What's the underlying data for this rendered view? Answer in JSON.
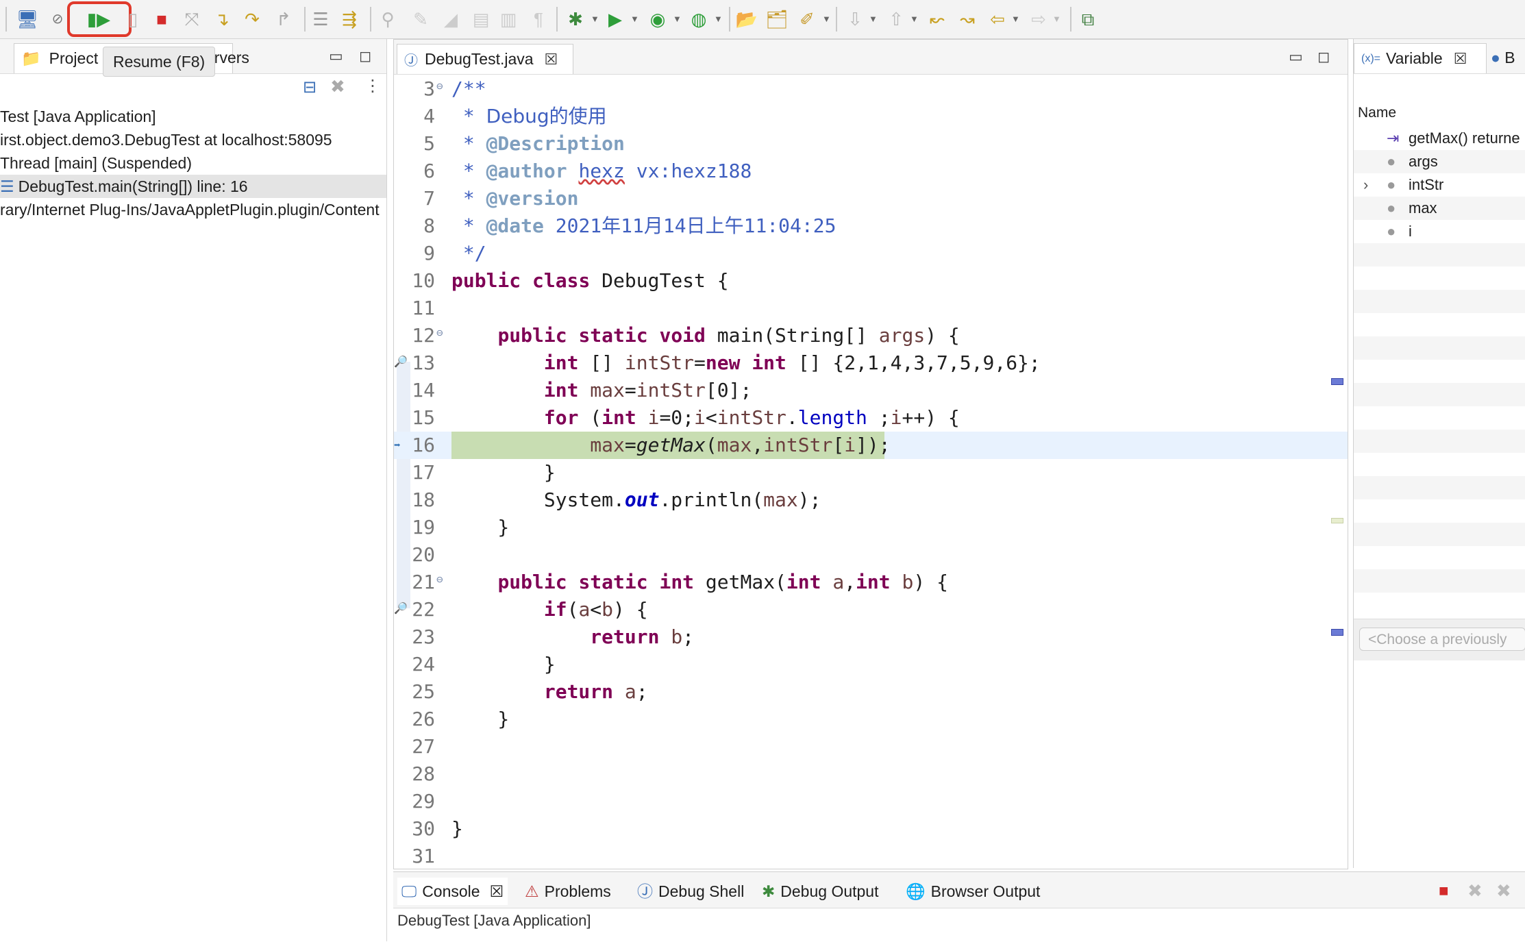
{
  "toolbar": {
    "tooltip": "Resume (F8)",
    "icons": [
      "display-icon",
      "skip-breakpoints-icon",
      "resume-icon",
      "suspend-icon",
      "terminate-icon",
      "disconnect-icon",
      "step-into-icon",
      "step-over-icon",
      "step-return-icon",
      "drop-to-frame-icon",
      "use-step-filters-icon",
      "debug-icon",
      "run-icon",
      "coverage-icon",
      "external-tools-icon",
      "open-type-icon",
      "open-task-icon",
      "search-icon",
      "next-annotation-icon",
      "prev-annotation-icon",
      "back-icon",
      "forward-icon",
      "new-window-icon"
    ]
  },
  "left_panel": {
    "tabs": {
      "project": "Project E",
      "servers": "ervers"
    },
    "tree": [
      "Test [Java Application]",
      "irst.object.demo3.DebugTest at localhost:58095",
      "Thread [main] (Suspended)",
      "DebugTest.main(String[]) line: 16",
      "rary/Internet Plug-Ins/JavaAppletPlugin.plugin/Content"
    ]
  },
  "editor": {
    "tab": "DebugTest.java",
    "line_numbers": [
      "3",
      "4",
      "5",
      "6",
      "7",
      "8",
      "9",
      "10",
      "11",
      "12",
      "13",
      "14",
      "15",
      "16",
      "17",
      "18",
      "19",
      "20",
      "21",
      "22",
      "23",
      "24",
      "25",
      "26",
      "27",
      "28",
      "29",
      "30",
      "31"
    ],
    "code": {
      "l3": "/**",
      "l4a": " * ",
      "l4b": "Debug的使用",
      "l5a": " * ",
      "l5b": "@Description",
      "l6a": " * ",
      "l6b": "@author",
      "l6c": " ",
      "l6d": "hexz",
      "l6e": " vx:hexz188",
      "l7a": " * ",
      "l7b": "@version",
      "l8a": " * ",
      "l8b": "@date",
      "l8c": " 2021年11月14日上午11:04:25",
      "l9": " */",
      "l10a": "public",
      "l10b": " ",
      "l10c": "class",
      "l10d": " DebugTest {",
      "l12a": "    ",
      "l12b": "public",
      "l12c": " ",
      "l12d": "static",
      "l12e": " ",
      "l12f": "void",
      "l12g": " main(String[] ",
      "l12h": "args",
      "l12i": ") {",
      "l13a": "        ",
      "l13b": "int",
      "l13c": " [] ",
      "l13d": "intStr",
      "l13e": "=",
      "l13f": "new",
      "l13g": " ",
      "l13h": "int",
      "l13i": " [] {2,1,4,3,7,5,9,6};",
      "l14a": "        ",
      "l14b": "int",
      "l14c": " ",
      "l14d": "max",
      "l14e": "=",
      "l14f": "intStr",
      "l14g": "[0];",
      "l15a": "        ",
      "l15b": "for",
      "l15c": " (",
      "l15d": "int",
      "l15e": " ",
      "l15f": "i",
      "l15g": "=0;",
      "l15h": "i",
      "l15i": "<",
      "l15j": "intStr",
      "l15k": ".",
      "l15l": "length",
      "l15m": " ;",
      "l15n": "i",
      "l15o": "++) {",
      "l16a": "            ",
      "l16b": "max",
      "l16c": "=",
      "l16d": "getMax",
      "l16e": "(",
      "l16f": "max",
      "l16g": ",",
      "l16h": "intStr",
      "l16i": "[",
      "l16j": "i",
      "l16k": "]);",
      "l17": "        }",
      "l18a": "        System.",
      "l18b": "out",
      "l18c": ".println(",
      "l18d": "max",
      "l18e": ");",
      "l19": "    }",
      "l21a": "    ",
      "l21b": "public",
      "l21c": " ",
      "l21d": "static",
      "l21e": " ",
      "l21f": "int",
      "l21g": " getMax(",
      "l21h": "int",
      "l21i": " ",
      "l21j": "a",
      "l21k": ",",
      "l21l": "int",
      "l21m": " ",
      "l21n": "b",
      "l21o": ") {",
      "l22a": "        ",
      "l22b": "if",
      "l22c": "(",
      "l22d": "a",
      "l22e": "<",
      "l22f": "b",
      "l22g": ") {",
      "l23a": "            ",
      "l23b": "return",
      "l23c": " ",
      "l23d": "b",
      "l23e": ";",
      "l24": "        }",
      "l25a": "        ",
      "l25b": "return",
      "l25c": " ",
      "l25d": "a",
      "l25e": ";",
      "l26": "    }",
      "l30": "}"
    }
  },
  "right_panel": {
    "tab": "Variable",
    "tab2": "B",
    "column": "Name",
    "rows": [
      "getMax() returne",
      "args",
      "intStr",
      "max",
      "i"
    ],
    "detail_placeholder": "<Choose a previously"
  },
  "console": {
    "tabs": [
      "Console",
      "Problems",
      "Debug Shell",
      "Debug Output",
      "Browser Output"
    ],
    "status": "DebugTest [Java Application]"
  }
}
